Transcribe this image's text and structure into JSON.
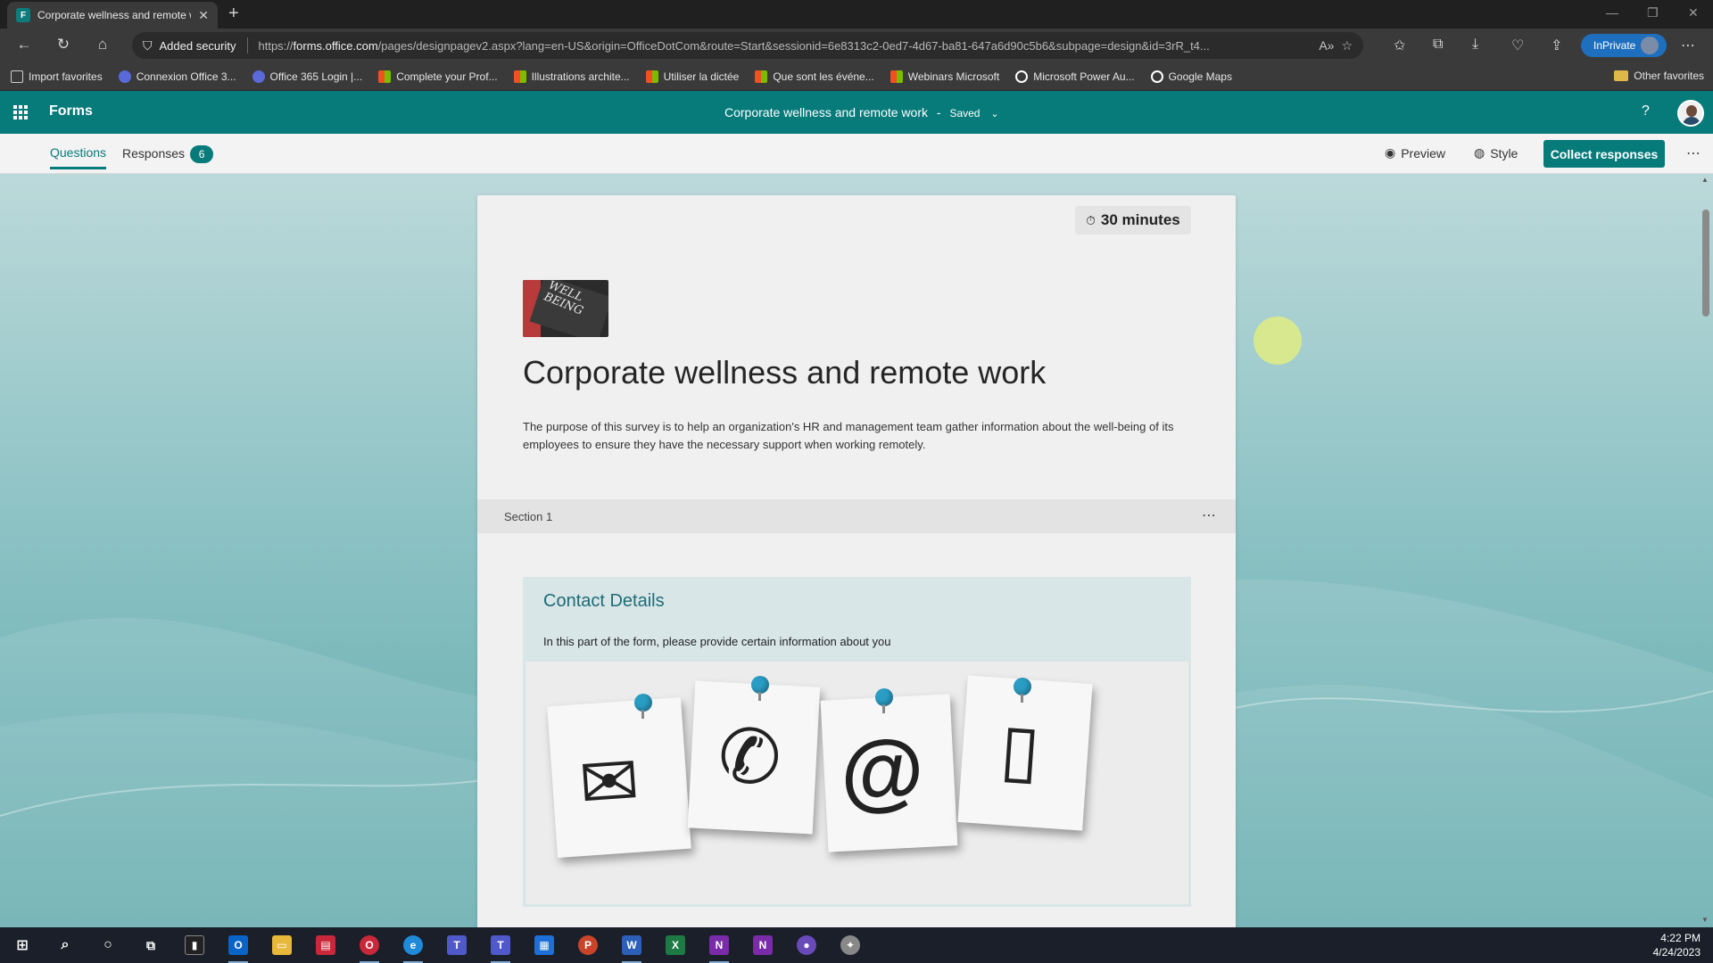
{
  "browser": {
    "tab_title": "Corporate wellness and remote w",
    "security_label": "Added security",
    "url_prefix": "https://",
    "url_domain": "forms.office.com",
    "url_rest": "/pages/designpagev2.aspx?lang=en-US&origin=OfficeDotCom&route=Start&sessionid=6e8313c2-0ed7-4d67-ba81-647a6d90c5b6&subpage=design&id=3rR_t4...",
    "inprivate_label": "InPrivate"
  },
  "favorites": [
    {
      "label": "Import favorites",
      "color": "#cfcfcf"
    },
    {
      "label": "Connexion Office 3...",
      "color": "#5a6ad8"
    },
    {
      "label": "Office 365 Login |...",
      "color": "#5a6ad8"
    },
    {
      "label": "Complete your Prof...",
      "color": "#e8a020"
    },
    {
      "label": "Illustrations archite...",
      "color": "#e8a020"
    },
    {
      "label": "Utiliser la dictée",
      "color": "#e8a020"
    },
    {
      "label": "Que sont les événe...",
      "color": "#e8a020"
    },
    {
      "label": "Webinars Microsoft",
      "color": "#e8a020"
    },
    {
      "label": "Microsoft Power Au...",
      "color": "#ffffff"
    },
    {
      "label": "Google Maps",
      "color": "#ffffff"
    }
  ],
  "other_favorites": "Other favorites",
  "forms_header": {
    "app_name": "Forms",
    "doc_title": "Corporate wellness and remote work",
    "separator": "-",
    "saved_status": "Saved",
    "help": "?"
  },
  "command_bar": {
    "questions_tab": "Questions",
    "responses_tab": "Responses",
    "responses_count": "6",
    "preview": "Preview",
    "style": "Style",
    "collect": "Collect responses"
  },
  "form": {
    "timer": "30 minutes",
    "image_text": "WELL BEING",
    "title": "Corporate wellness and remote work",
    "description": "The purpose of this survey is to help an organization's HR and management team gather information about the well-being of its employees to ensure they have the necessary support when working remotely.",
    "section_label": "Section 1",
    "contact_title": "Contact Details",
    "contact_desc": "In this part of the form, please provide certain information about you",
    "contact_icons": [
      "envelope-icon",
      "phone-icon",
      "at-sign-icon",
      "mobile-phone-icon"
    ]
  },
  "taskbar": {
    "time": "4:22 PM",
    "date": "4/24/2023"
  },
  "colors": {
    "forms_teal": "#077a7a",
    "contact_title": "#1d6b75",
    "pin_blue": "#2a9dc4"
  }
}
